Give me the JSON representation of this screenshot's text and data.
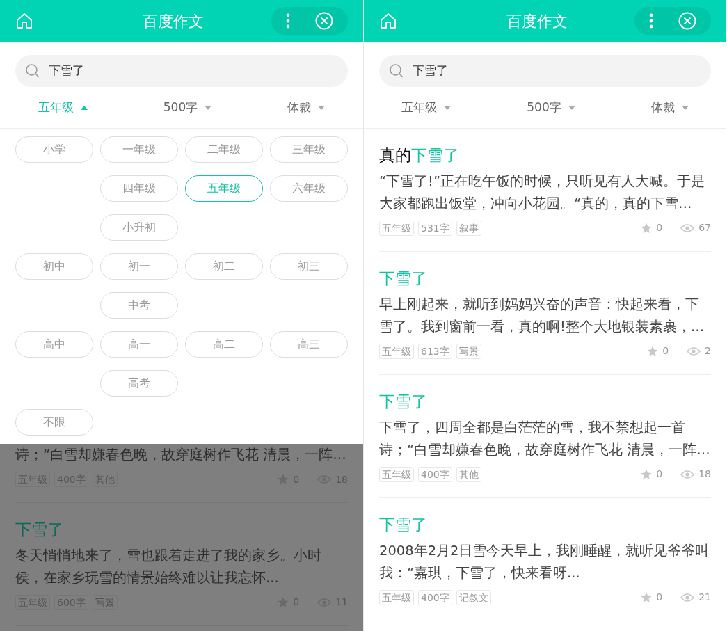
{
  "screens": [
    {
      "header": {
        "title": "百度作文"
      },
      "search": {
        "value": "下雪了"
      },
      "filters": [
        {
          "label": "五年级",
          "selected": true
        },
        {
          "label": "500字",
          "selected": false
        },
        {
          "label": "体裁",
          "selected": false
        }
      ],
      "grade_panel": {
        "groups": [
          {
            "label": "小学",
            "selected": false,
            "options": [
              {
                "label": "一年级",
                "selected": false
              },
              {
                "label": "二年级",
                "selected": false
              },
              {
                "label": "三年级",
                "selected": false
              },
              {
                "label": "四年级",
                "selected": false
              },
              {
                "label": "五年级",
                "selected": true
              },
              {
                "label": "六年级",
                "selected": false
              },
              {
                "label": "小升初",
                "selected": false
              }
            ]
          },
          {
            "label": "初中",
            "selected": false,
            "options": [
              {
                "label": "初一",
                "selected": false
              },
              {
                "label": "初二",
                "selected": false
              },
              {
                "label": "初三",
                "selected": false
              },
              {
                "label": "中考",
                "selected": false
              }
            ]
          },
          {
            "label": "高中",
            "selected": false,
            "options": [
              {
                "label": "高一",
                "selected": false
              },
              {
                "label": "高二",
                "selected": false
              },
              {
                "label": "高三",
                "selected": false
              },
              {
                "label": "高考",
                "selected": false
              }
            ]
          },
          {
            "label": "不限",
            "selected": false
          }
        ]
      },
      "articles": [
        {
          "partial": true,
          "excerpt": "诗；“白雪却嫌春色晚，故穿庭树作飞花 清晨，一阵…",
          "tags": [
            "五年级",
            "400字",
            "其他"
          ],
          "likes": "0",
          "views": "18"
        },
        {
          "title": [
            {
              "text": "下雪了",
              "match": true
            }
          ],
          "excerpt": "冬天悄悄地来了，雪也跟着走进了我的家乡。小时侯，在家乡玩雪的情景始终难以让我忘怀...",
          "tags": [
            "五年级",
            "600字",
            "写景"
          ],
          "likes": "0",
          "views": "11"
        }
      ]
    },
    {
      "header": {
        "title": "百度作文"
      },
      "search": {
        "value": "下雪了"
      },
      "filters": [
        {
          "label": "五年级",
          "selected": false
        },
        {
          "label": "500字",
          "selected": false
        },
        {
          "label": "体裁",
          "selected": false
        }
      ],
      "articles": [
        {
          "title": [
            {
              "text": "真的",
              "match": false
            },
            {
              "text": "下雪了",
              "match": true
            }
          ],
          "excerpt": "“下雪了!”正在吃午饭的时候，只听见有人大喊。于是大家都跑出饭堂，冲向小花园。“真的，真的下雪…",
          "tags": [
            "五年级",
            "531字",
            "叙事"
          ],
          "likes": "0",
          "views": "67"
        },
        {
          "title": [
            {
              "text": "下雪了",
              "match": true
            }
          ],
          "excerpt": "早上刚起来，就听到妈妈兴奋的声音：快起来看，下雪了。我到窗前一看，真的啊!整个大地银装素裹，…",
          "tags": [
            "五年级",
            "613字",
            "写景"
          ],
          "likes": "0",
          "views": "2"
        },
        {
          "title": [
            {
              "text": "下雪了",
              "match": true
            }
          ],
          "excerpt": "下雪了，四周全都是白茫茫的雪，我不禁想起一首诗；“白雪却嫌春色晚，故穿庭树作飞花 清晨，一阵…",
          "tags": [
            "五年级",
            "400字",
            "其他"
          ],
          "likes": "0",
          "views": "18"
        },
        {
          "title": [
            {
              "text": "下雪了",
              "match": true
            }
          ],
          "excerpt": "2008年2月2日雪今天早上，我刚睡醒，就听见爷爷叫我：“嘉琪，下雪了，快来看呀...",
          "tags": [
            "五年级",
            "400字",
            "记叙文"
          ],
          "likes": "0",
          "views": "21"
        }
      ]
    }
  ]
}
